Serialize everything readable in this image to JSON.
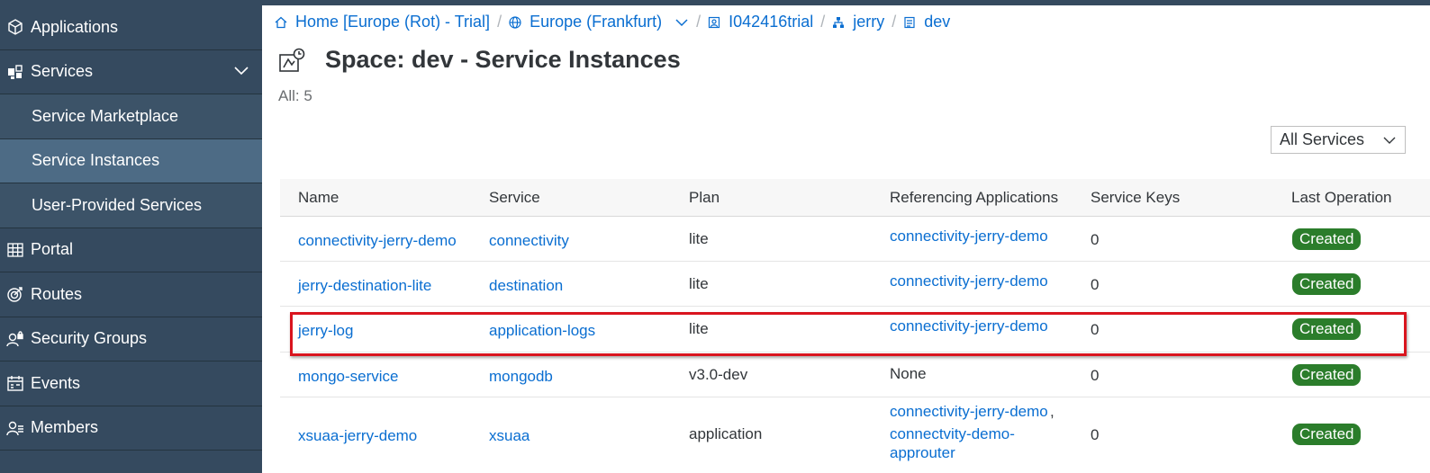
{
  "sidebar": {
    "items": [
      {
        "label": "Applications",
        "icon": "cube-icon"
      },
      {
        "label": "Services",
        "icon": "services-icon",
        "expanded": true
      },
      {
        "label": "Service Marketplace",
        "sub": true
      },
      {
        "label": "Service Instances",
        "sub": true,
        "active": true
      },
      {
        "label": "User-Provided Services",
        "sub": true
      },
      {
        "label": "Portal",
        "icon": "grid-icon"
      },
      {
        "label": "Routes",
        "icon": "target-icon"
      },
      {
        "label": "Security Groups",
        "icon": "user-lock-icon"
      },
      {
        "label": "Events",
        "icon": "calendar-icon"
      },
      {
        "label": "Members",
        "icon": "members-icon"
      }
    ]
  },
  "breadcrumb": {
    "home": "Home [Europe (Rot) - Trial]",
    "region": "Europe (Frankfurt)",
    "account": "I042416trial",
    "org": "jerry",
    "space": "dev"
  },
  "page": {
    "title": "Space: dev - Service Instances",
    "count": "All: 5",
    "filter": "All Services"
  },
  "table": {
    "columns": [
      "Name",
      "Service",
      "Plan",
      "Referencing Applications",
      "Service Keys",
      "Last Operation"
    ],
    "rows": [
      {
        "name": "connectivity-jerry-demo",
        "service": "connectivity",
        "plan": "lite",
        "apps": "connectivity-jerry-demo",
        "keys": "0",
        "status": "Created"
      },
      {
        "name": "jerry-destination-lite",
        "service": "destination",
        "plan": "lite",
        "apps": "connectivity-jerry-demo",
        "keys": "0",
        "status": "Created"
      },
      {
        "name": "jerry-log",
        "service": "application-logs",
        "plan": "lite",
        "apps": "connectivity-jerry-demo",
        "keys": "0",
        "status": "Created"
      },
      {
        "name": "mongo-service",
        "service": "mongodb",
        "plan": "v3.0-dev",
        "apps": "None",
        "keys": "0",
        "status": "Created"
      },
      {
        "name": "xsuaa-jerry-demo",
        "service": "xsuaa",
        "plan": "application",
        "apps": "connectivity-jerry-demo",
        "apps2": "connectvity-demo-",
        "apps3": "approuter",
        "keys": "0",
        "status": "Created"
      }
    ]
  },
  "colors": {
    "sidebar": "#354a5f",
    "link": "#0a6ed1",
    "status": "#2b7d2b",
    "highlight": "#d9141e"
  }
}
